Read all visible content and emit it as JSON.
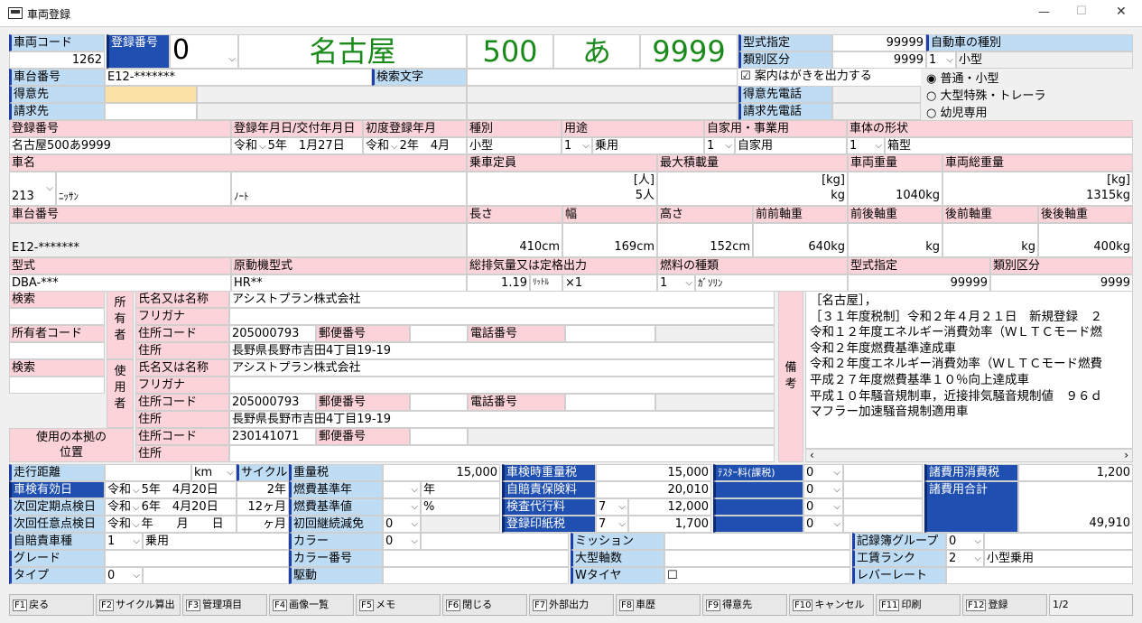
{
  "window": {
    "title": "車両登録",
    "min": "—",
    "max": "☐",
    "close": "✕"
  },
  "head": {
    "vehicle_code_lbl": "車両コード",
    "vehicle_code": "1262",
    "reg_no_lbl": "登録番号",
    "reg_no_val": "0",
    "plate_area": "名古屋",
    "plate_class": "500",
    "plate_kana": "あ",
    "plate_num": "9999",
    "model_spec_lbl": "型式指定",
    "model_spec": "99999",
    "cat_lbl": "類別区分",
    "cat": "9999",
    "auto_type_lbl": "自動車の種別",
    "auto_type_code": "1",
    "auto_type": "小型",
    "chassis_lbl": "車台番号",
    "chassis": "E12-*******",
    "search_text_lbl": "検索文字",
    "postcard_lbl": "案内はがきを出力する",
    "customer_lbl": "得意先",
    "customer_tel_lbl": "得意先電話",
    "billing_lbl": "請求先",
    "billing_tel_lbl": "請求先電話",
    "radio1": "普通・小型",
    "radio2": "大型特殊・トレーラ",
    "radio3": "幼児専用"
  },
  "reg": {
    "h1": "登録番号",
    "h2": "登録年月日/交付年月日",
    "h3": "初度登録年月",
    "h4": "種別",
    "h5": "用途",
    "h6": "自家用・事業用",
    "h7": "車体の形状",
    "plate": "名古屋500あ9999",
    "era1": "令和",
    "date1": "5年　1月27日",
    "era2": "令和",
    "date2": "2年　4月",
    "kind": "小型",
    "use_code": "1",
    "use": "乗用",
    "biz_code": "1",
    "biz": "自家用",
    "shape_code": "1",
    "shape": "箱型"
  },
  "spec": {
    "name_lbl": "車名",
    "cap_lbl": "乗車定員",
    "load_lbl": "最大積載量",
    "weight_lbl": "車両重量",
    "gross_lbl": "車両総重量",
    "maker_code": "213",
    "maker": "ﾆｯｻﾝ",
    "model_name": "ﾉｰﾄ",
    "cap_unit": "[人]",
    "cap": "5人",
    "load_unit": "[kg]",
    "load": "kg",
    "weight": "1040kg",
    "gross_unit": "[kg]",
    "gross": "1315kg",
    "chassis_lbl": "車台番号",
    "len_lbl": "長さ",
    "wid_lbl": "幅",
    "hei_lbl": "高さ",
    "ff_lbl": "前前軸重",
    "fr_lbl": "前後軸重",
    "rf_lbl": "後前軸重",
    "rr_lbl": "後後軸重",
    "chassis": "E12-*******",
    "len": "410cm",
    "wid": "169cm",
    "hei": "152cm",
    "ff": "640kg",
    "fr": "kg",
    "rf": "kg",
    "rr": "400kg",
    "type_lbl": "型式",
    "engine_lbl": "原動機型式",
    "disp_lbl": "総排気量又は定格出力",
    "fuel_lbl": "燃料の種類",
    "spec_lbl": "型式指定",
    "cat_lbl": "類別区分",
    "type": "DBA-***",
    "engine": "HR**",
    "disp": "1.19",
    "disp_unit": "ﾘｯﾄﾙ",
    "disp_mult": "×1",
    "fuel_code": "1",
    "fuel": "ｶﾞｿﾘﾝ",
    "spec": "99999",
    "cat": "9999"
  },
  "owner": {
    "search_lbl": "検索",
    "owner_code_lbl": "所有者コード",
    "owner_vlbl": "所有者",
    "user_vlbl": "使用者",
    "base_lbl": "使用の本拠の位置",
    "name_lbl": "氏名又は名称",
    "kana_lbl": "フリガナ",
    "addr_code_lbl": "住所コード",
    "zip_lbl": "郵便番号",
    "tel_lbl": "電話番号",
    "addr_lbl": "住所",
    "o_name": "アシストプラン株式会社",
    "o_code": "205000793",
    "o_addr": "長野県長野市吉田4丁目19-19",
    "u_name": "アシストプラン株式会社",
    "u_code": "205000793",
    "u_addr": "長野県長野市吉田4丁目19-19",
    "b_code": "230141071"
  },
  "remarks": {
    "lbl": "備考",
    "text": "［名古屋］，\n［３１年度税制］令和２年４月２１日　新規登録　２\n令和１２年度エネルギー消費効率（ＷＬＴＣモード燃\n令和２年度燃費基準達成車\n令和２年度エネルギー消費効率（ＷＬＴＣモード燃費\n平成２７年度燃費基準１０％向上達成車\n平成１０年騒音規制車，近接排気騒音規制値　９６ｄ\nマフラー加速騒音規制適用車",
    "scroll_left": "‹",
    "scroll_right": "›"
  },
  "bottom": {
    "mileage_lbl": "走行距離",
    "km": "km",
    "cycle_lbl": "サイクル",
    "wtax_lbl": "重量税",
    "wtax": "15,000",
    "inspect_wtax_lbl": "車検時重量税",
    "inspect_wtax": "15,000",
    "tester_lbl": "ﾃｽﾀｰ料(課税)",
    "tester_code": "0",
    "misc_tax_lbl": "諸費用消費税",
    "misc_tax": "1,200",
    "expiry_lbl": "車検有効日",
    "era": "令和",
    "exp_date": "5年　4月20日",
    "cycle_val": "2年",
    "fuel_year_lbl": "燃費基準年",
    "year_unit": "年",
    "ins_lbl": "自賠責保険料",
    "ins": "20,010",
    "z2": "0",
    "misc_total_lbl": "諸費用合計",
    "next_reg_lbl": "次回定期点検日",
    "next_reg_date": "6年　4月20日",
    "months": "12ヶ月",
    "fuel_val_lbl": "燃費基準値",
    "pct": "%",
    "agent_lbl": "検査代行料",
    "agent_code": "7",
    "agent": "12,000",
    "z3": "0",
    "next_opt_lbl": "次回任意点検日",
    "next_opt_date": "年　　月　　日",
    "months2": "ヶ月",
    "cont_lbl": "初回継続減免",
    "cont": "0",
    "stamp_lbl": "登録印紙税",
    "stamp_code": "7",
    "stamp": "1,700",
    "z4": "0",
    "total": "49,910",
    "cmpl_lbl": "自賠責車種",
    "cmpl_code": "1",
    "cmpl": "乗用",
    "color_lbl": "カラー",
    "color": "0",
    "mission_lbl": "ミッション",
    "group_lbl": "記録簿グループ",
    "group": "0",
    "grade_lbl": "グレード",
    "color_no_lbl": "カラー番号",
    "axles_lbl": "大型軸数",
    "rank_lbl": "工賃ランク",
    "rank_code": "2",
    "rank": "小型乗用",
    "type_lbl": "タイプ",
    "type": "0",
    "drive_lbl": "駆動",
    "wtire_lbl": "Wタイヤ",
    "lever_lbl": "レバーレート"
  },
  "fkeys": {
    "f1": "F1",
    "l1": "戻る",
    "f2": "F2",
    "l2": "サイクル算出",
    "f3": "F3",
    "l3": "管理項目",
    "f4": "F4",
    "l4": "画像一覧",
    "f5": "F5",
    "l5": "メモ",
    "f6": "F6",
    "l6": "閉じる",
    "f7": "F7",
    "l7": "外部出力",
    "f8": "F8",
    "l8": "車歴",
    "f9": "F9",
    "l9": "得意先",
    "f10": "F10",
    "l10": "キャンセル",
    "f11": "F11",
    "l11": "印刷",
    "f12": "F12",
    "l12": "登録",
    "page": "1/2"
  },
  "colors": {
    "pink": "#fbd3d9",
    "blue_label": "#bfdcf5",
    "dark_blue": "#1f4fb0",
    "plate_green": "#1a8a1a",
    "highlight": "#fbe1a6"
  }
}
